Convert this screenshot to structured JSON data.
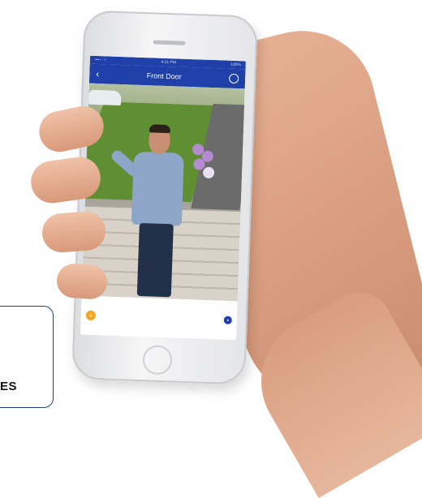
{
  "app": {
    "status_time": "4:21 PM",
    "status_battery": "100%",
    "nav_title": "Front Door",
    "back_icon": "chevron-left-icon",
    "history_icon": "history-icon"
  },
  "controls": {
    "talk_icon": "talk-icon",
    "settings_icon": "gear-icon"
  },
  "callout": {
    "text": "ES"
  },
  "colors": {
    "header_blue": "#1e40a8",
    "accent_orange": "#f3a41c"
  }
}
